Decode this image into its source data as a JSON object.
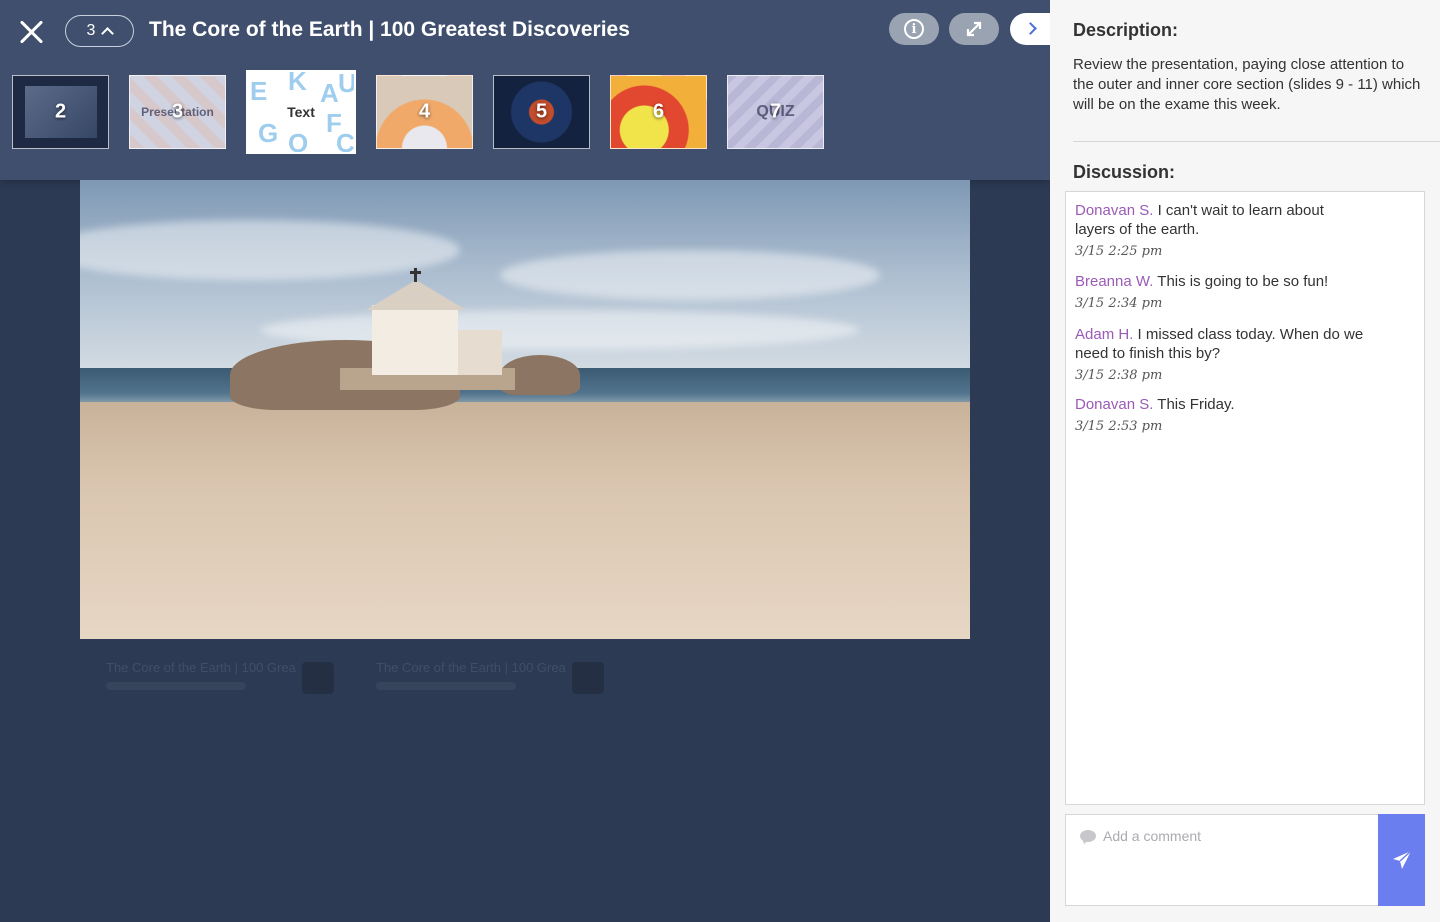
{
  "viewer": {
    "title": "The Core of the Earth | 100 Greatest Discoveries",
    "current_slide": "3",
    "thumbnails": [
      {
        "num": "2",
        "sub": ""
      },
      {
        "num": "3",
        "sub": "Presentation"
      },
      {
        "num": "",
        "sub": "Text"
      },
      {
        "num": "4",
        "sub": ""
      },
      {
        "num": "5",
        "sub": ""
      },
      {
        "num": "6",
        "sub": ""
      },
      {
        "num": "7",
        "sub": "QUIZ"
      }
    ],
    "icons": {
      "close": "close-icon",
      "info": "info-icon",
      "expand": "expand-icon",
      "next": "chevron-right-icon"
    }
  },
  "panel": {
    "description_heading": "Description:",
    "description": "Review the presentation, paying close attention to the outer and inner core section (slides 9 - 11) which will be on the exame this week.",
    "discussion_heading": "Discussion:",
    "comments": [
      {
        "name": "Donavan S.",
        "text": "I can't wait to learn about layers of the earth.",
        "time": "3/15 2:25 pm"
      },
      {
        "name": "Breanna W.",
        "text": "This is going to be so fun!",
        "time": "3/15 2:34 pm"
      },
      {
        "name": "Adam H.",
        "text": "I missed class today. When do we need to finish this by?",
        "time": "3/15 2:38 pm"
      },
      {
        "name": "Donavan S.",
        "text": "This Friday.",
        "time": "3/15 2:53 pm"
      }
    ],
    "comment_placeholder": "Add a comment",
    "colors": {
      "name": "#9b5bb7",
      "send": "#6a7ef0",
      "topbar": "#3f4f6d"
    }
  }
}
